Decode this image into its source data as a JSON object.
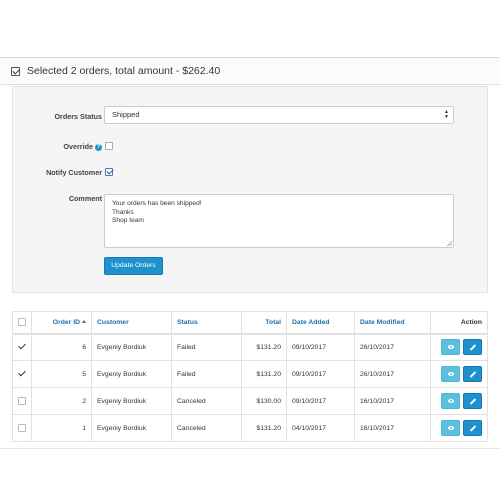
{
  "heading": {
    "text": "Selected 2 orders, total amount - $262.40"
  },
  "form": {
    "status_label": "Orders Status",
    "status_value": "Shipped",
    "override_label": "Override",
    "override_checked": false,
    "notify_label": "Notify Customer",
    "notify_checked": true,
    "comment_label": "Comment",
    "comment_value": "Your orders has been shipped!\nThanks\nShop team",
    "submit_label": "Update Orders"
  },
  "table": {
    "columns": {
      "order_id": "Order ID",
      "customer": "Customer",
      "status": "Status",
      "total": "Total",
      "date_added": "Date Added",
      "date_modified": "Date Modified",
      "action": "Action"
    },
    "rows": [
      {
        "checked": true,
        "order_id": "6",
        "customer": "Evgeniy Bordiuk",
        "status": "Failed",
        "total": "$131.20",
        "date_added": "09/10/2017",
        "date_modified": "26/10/2017"
      },
      {
        "checked": true,
        "order_id": "5",
        "customer": "Evgeniy Bordiuk",
        "status": "Failed",
        "total": "$131.20",
        "date_added": "09/10/2017",
        "date_modified": "26/10/2017"
      },
      {
        "checked": false,
        "order_id": "2",
        "customer": "Evgeniy Bordiuk",
        "status": "Canceled",
        "total": "$130.00",
        "date_added": "09/10/2017",
        "date_modified": "16/10/2017"
      },
      {
        "checked": false,
        "order_id": "1",
        "customer": "Evgeniy Bordiuk",
        "status": "Canceled",
        "total": "$131.20",
        "date_added": "04/10/2017",
        "date_modified": "16/10/2017"
      }
    ]
  },
  "colors": {
    "primary": "#1e91cf",
    "info": "#5bc0de",
    "link": "#1e6fa6"
  }
}
